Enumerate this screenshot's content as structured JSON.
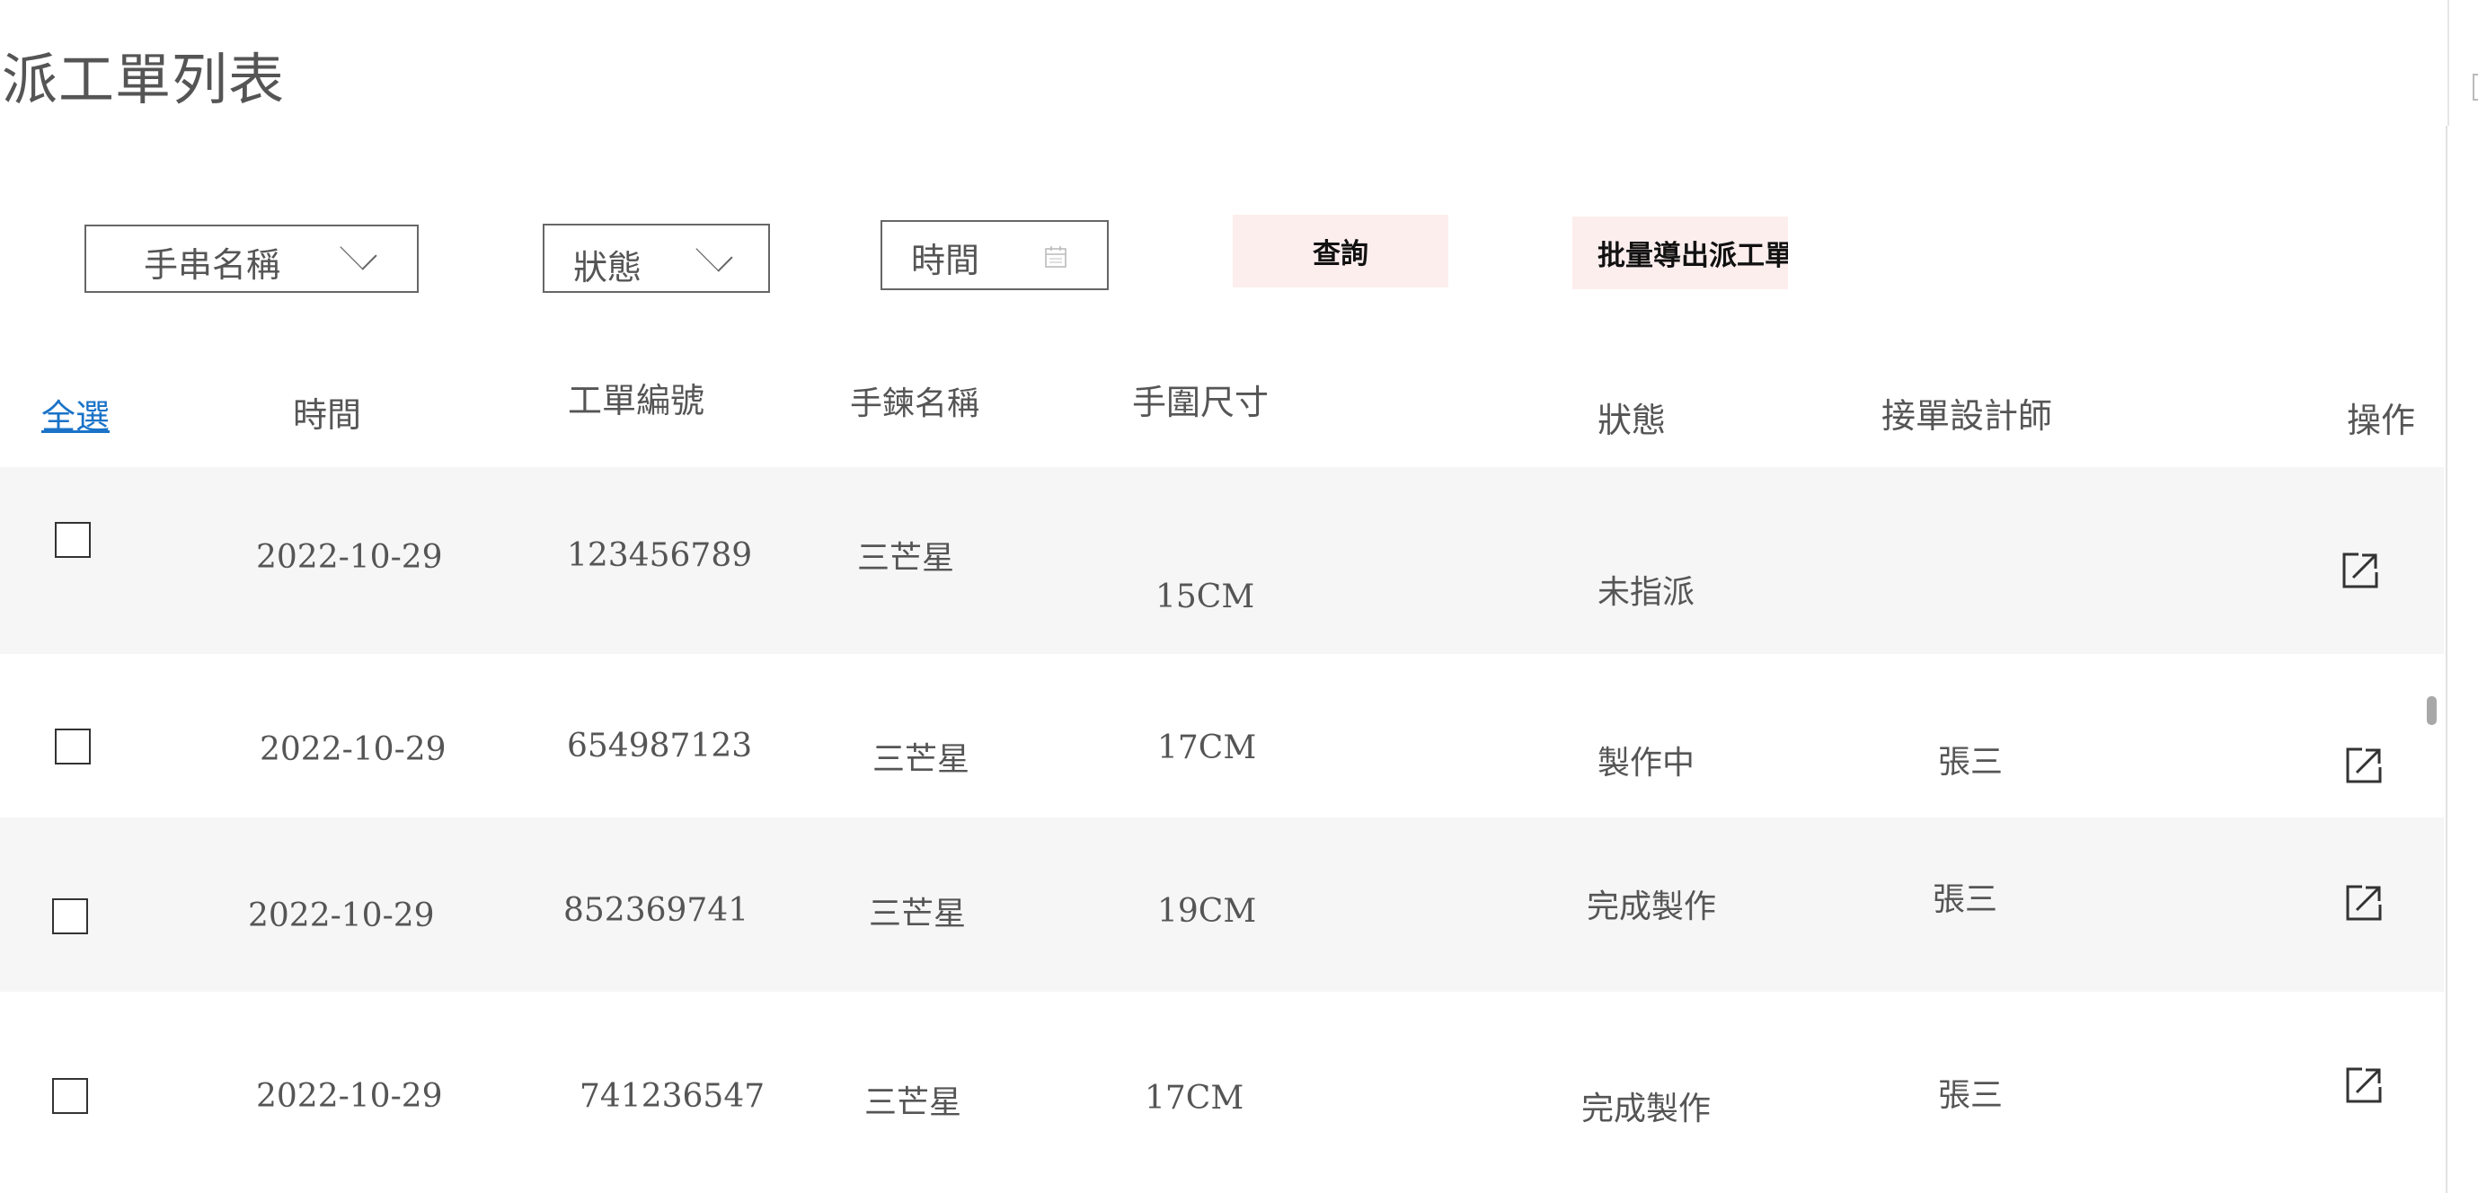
{
  "page": {
    "title": "派工單列表"
  },
  "filters": {
    "bracelet_name": "手串名稱",
    "status": "狀態",
    "time": "時間"
  },
  "buttons": {
    "query": "查詢",
    "batch_export": "批量導出派工單"
  },
  "columns": {
    "select_all": "全選",
    "time": "時間",
    "order_no": "工單編號",
    "bracelet_name": "手鍊名稱",
    "wrist_size": "手圍尺寸",
    "status": "狀態",
    "designer": "接單設計師",
    "action": "操作"
  },
  "rows": [
    {
      "time": "2022-10-29",
      "order_no": "123456789",
      "name": "三芒星",
      "size": "15CM",
      "status": "未指派",
      "designer": ""
    },
    {
      "time": "2022-10-29",
      "order_no": "654987123",
      "name": "三芒星",
      "size": "17CM",
      "status": "製作中",
      "designer": "張三"
    },
    {
      "time": "2022-10-29",
      "order_no": "852369741",
      "name": "三芒星",
      "size": "19CM",
      "status": "完成製作",
      "designer": "張三"
    },
    {
      "time": "2022-10-29",
      "order_no": "741236547",
      "name": "三芒星",
      "size": "17CM",
      "status": "完成製作",
      "designer": "張三"
    }
  ],
  "icons": {
    "dropdown": "chevron-down-icon",
    "calendar": "calendar-icon",
    "open": "external-link-icon"
  },
  "colors": {
    "button_bg": "#fdeeee",
    "row_stripe": "#f6f6f6",
    "link": "#1a73c8"
  }
}
